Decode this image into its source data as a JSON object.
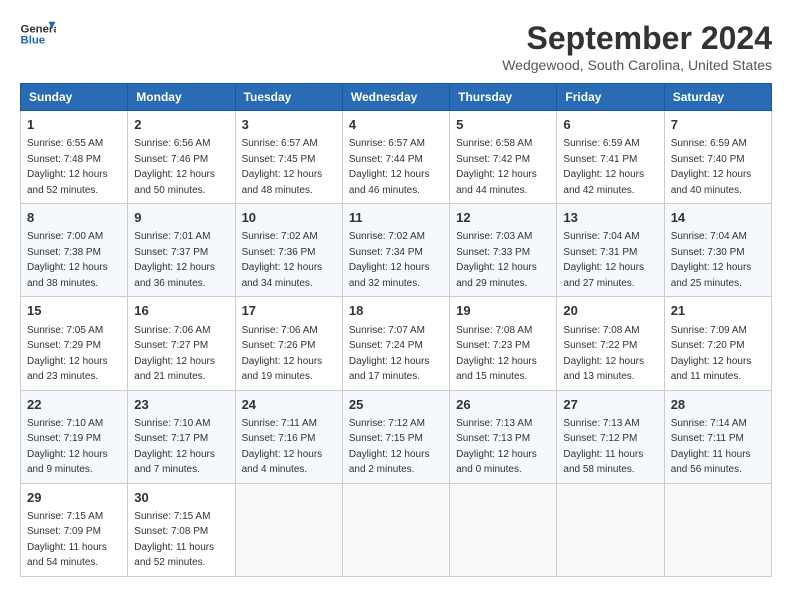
{
  "logo": {
    "line1": "General",
    "line2": "Blue"
  },
  "title": "September 2024",
  "subtitle": "Wedgewood, South Carolina, United States",
  "days_of_week": [
    "Sunday",
    "Monday",
    "Tuesday",
    "Wednesday",
    "Thursday",
    "Friday",
    "Saturday"
  ],
  "weeks": [
    [
      {
        "day": "1",
        "sunrise": "6:55 AM",
        "sunset": "7:48 PM",
        "daylight": "12 hours and 52 minutes."
      },
      {
        "day": "2",
        "sunrise": "6:56 AM",
        "sunset": "7:46 PM",
        "daylight": "12 hours and 50 minutes."
      },
      {
        "day": "3",
        "sunrise": "6:57 AM",
        "sunset": "7:45 PM",
        "daylight": "12 hours and 48 minutes."
      },
      {
        "day": "4",
        "sunrise": "6:57 AM",
        "sunset": "7:44 PM",
        "daylight": "12 hours and 46 minutes."
      },
      {
        "day": "5",
        "sunrise": "6:58 AM",
        "sunset": "7:42 PM",
        "daylight": "12 hours and 44 minutes."
      },
      {
        "day": "6",
        "sunrise": "6:59 AM",
        "sunset": "7:41 PM",
        "daylight": "12 hours and 42 minutes."
      },
      {
        "day": "7",
        "sunrise": "6:59 AM",
        "sunset": "7:40 PM",
        "daylight": "12 hours and 40 minutes."
      }
    ],
    [
      {
        "day": "8",
        "sunrise": "7:00 AM",
        "sunset": "7:38 PM",
        "daylight": "12 hours and 38 minutes."
      },
      {
        "day": "9",
        "sunrise": "7:01 AM",
        "sunset": "7:37 PM",
        "daylight": "12 hours and 36 minutes."
      },
      {
        "day": "10",
        "sunrise": "7:02 AM",
        "sunset": "7:36 PM",
        "daylight": "12 hours and 34 minutes."
      },
      {
        "day": "11",
        "sunrise": "7:02 AM",
        "sunset": "7:34 PM",
        "daylight": "12 hours and 32 minutes."
      },
      {
        "day": "12",
        "sunrise": "7:03 AM",
        "sunset": "7:33 PM",
        "daylight": "12 hours and 29 minutes."
      },
      {
        "day": "13",
        "sunrise": "7:04 AM",
        "sunset": "7:31 PM",
        "daylight": "12 hours and 27 minutes."
      },
      {
        "day": "14",
        "sunrise": "7:04 AM",
        "sunset": "7:30 PM",
        "daylight": "12 hours and 25 minutes."
      }
    ],
    [
      {
        "day": "15",
        "sunrise": "7:05 AM",
        "sunset": "7:29 PM",
        "daylight": "12 hours and 23 minutes."
      },
      {
        "day": "16",
        "sunrise": "7:06 AM",
        "sunset": "7:27 PM",
        "daylight": "12 hours and 21 minutes."
      },
      {
        "day": "17",
        "sunrise": "7:06 AM",
        "sunset": "7:26 PM",
        "daylight": "12 hours and 19 minutes."
      },
      {
        "day": "18",
        "sunrise": "7:07 AM",
        "sunset": "7:24 PM",
        "daylight": "12 hours and 17 minutes."
      },
      {
        "day": "19",
        "sunrise": "7:08 AM",
        "sunset": "7:23 PM",
        "daylight": "12 hours and 15 minutes."
      },
      {
        "day": "20",
        "sunrise": "7:08 AM",
        "sunset": "7:22 PM",
        "daylight": "12 hours and 13 minutes."
      },
      {
        "day": "21",
        "sunrise": "7:09 AM",
        "sunset": "7:20 PM",
        "daylight": "12 hours and 11 minutes."
      }
    ],
    [
      {
        "day": "22",
        "sunrise": "7:10 AM",
        "sunset": "7:19 PM",
        "daylight": "12 hours and 9 minutes."
      },
      {
        "day": "23",
        "sunrise": "7:10 AM",
        "sunset": "7:17 PM",
        "daylight": "12 hours and 7 minutes."
      },
      {
        "day": "24",
        "sunrise": "7:11 AM",
        "sunset": "7:16 PM",
        "daylight": "12 hours and 4 minutes."
      },
      {
        "day": "25",
        "sunrise": "7:12 AM",
        "sunset": "7:15 PM",
        "daylight": "12 hours and 2 minutes."
      },
      {
        "day": "26",
        "sunrise": "7:13 AM",
        "sunset": "7:13 PM",
        "daylight": "12 hours and 0 minutes."
      },
      {
        "day": "27",
        "sunrise": "7:13 AM",
        "sunset": "7:12 PM",
        "daylight": "11 hours and 58 minutes."
      },
      {
        "day": "28",
        "sunrise": "7:14 AM",
        "sunset": "7:11 PM",
        "daylight": "11 hours and 56 minutes."
      }
    ],
    [
      {
        "day": "29",
        "sunrise": "7:15 AM",
        "sunset": "7:09 PM",
        "daylight": "11 hours and 54 minutes."
      },
      {
        "day": "30",
        "sunrise": "7:15 AM",
        "sunset": "7:08 PM",
        "daylight": "11 hours and 52 minutes."
      },
      null,
      null,
      null,
      null,
      null
    ]
  ]
}
